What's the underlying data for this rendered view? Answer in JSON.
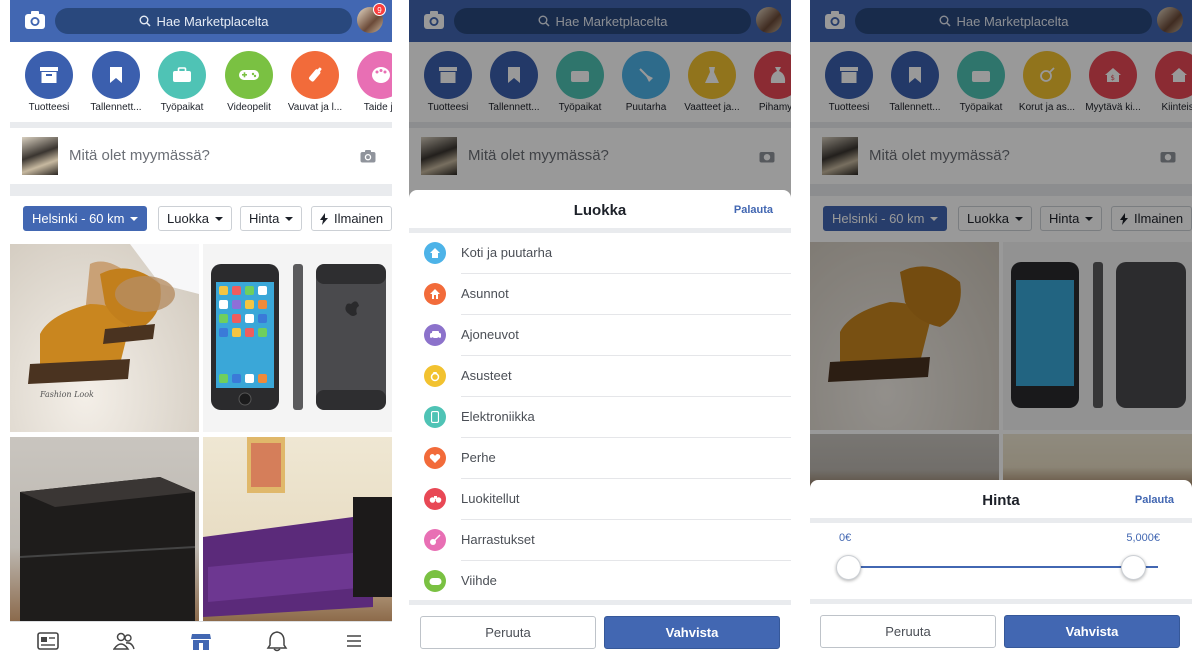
{
  "header": {
    "search_placeholder": "Hae Marketplacelta",
    "notifications": "9"
  },
  "screen1": {
    "categories": [
      {
        "label": "Tuotteesi",
        "color": "#3b5fae",
        "icon": "box-icon"
      },
      {
        "label": "Tallennett...",
        "color": "#3b5fae",
        "icon": "bookmark-icon"
      },
      {
        "label": "Työpaikat",
        "color": "#4fc3b5",
        "icon": "briefcase-icon"
      },
      {
        "label": "Videopelit",
        "color": "#7ac142",
        "icon": "gamepad-icon"
      },
      {
        "label": "Vauvat ja l...",
        "color": "#f26b3a",
        "icon": "baby-bottle-icon"
      },
      {
        "label": "Taide ja",
        "color": "#e86fb4",
        "icon": "palette-icon"
      }
    ],
    "composer_placeholder": "Mitä olet myymässä?",
    "filters": {
      "location": "Helsinki - 60 km",
      "category": "Luokka",
      "price": "Hinta",
      "free": "Ilmainen"
    }
  },
  "screen2": {
    "categories": [
      {
        "label": "Tuotteesi",
        "color": "#3b5fae",
        "icon": "box-icon"
      },
      {
        "label": "Tallennett...",
        "color": "#3b5fae",
        "icon": "bookmark-icon"
      },
      {
        "label": "Työpaikat",
        "color": "#4fc3b5",
        "icon": "briefcase-icon"
      },
      {
        "label": "Puutarha",
        "color": "#4db3e8",
        "icon": "shovel-icon"
      },
      {
        "label": "Vaatteet ja...",
        "color": "#f2c230",
        "icon": "dress-icon"
      },
      {
        "label": "Pihamyy",
        "color": "#e84855",
        "icon": "money-bag-icon"
      }
    ],
    "sheet": {
      "title": "Luokka",
      "reset": "Palauta",
      "items": [
        {
          "label": "Koti ja puutarha",
          "color": "#4db3e8",
          "icon": "house-icon"
        },
        {
          "label": "Asunnot",
          "color": "#f26b3a",
          "icon": "home-icon"
        },
        {
          "label": "Ajoneuvot",
          "color": "#8c72cb",
          "icon": "car-icon"
        },
        {
          "label": "Asusteet",
          "color": "#f2c230",
          "icon": "ring-icon"
        },
        {
          "label": "Elektroniikka",
          "color": "#4fc3b5",
          "icon": "phone-icon"
        },
        {
          "label": "Perhe",
          "color": "#f26b3a",
          "icon": "heart-icon"
        },
        {
          "label": "Luokitellut",
          "color": "#e84855",
          "icon": "binoculars-icon"
        },
        {
          "label": "Harrastukset",
          "color": "#e86fb4",
          "icon": "guitar-icon"
        },
        {
          "label": "Viihde",
          "color": "#7ac142",
          "icon": "gamepad-icon"
        }
      ],
      "cancel": "Peruuta",
      "confirm": "Vahvista"
    }
  },
  "screen3": {
    "categories": [
      {
        "label": "Tuotteesi",
        "color": "#3b5fae",
        "icon": "box-icon"
      },
      {
        "label": "Tallennett...",
        "color": "#3b5fae",
        "icon": "bookmark-icon"
      },
      {
        "label": "Työpaikat",
        "color": "#4fc3b5",
        "icon": "briefcase-icon"
      },
      {
        "label": "Korut ja as...",
        "color": "#f2c230",
        "icon": "ring-icon"
      },
      {
        "label": "Myytävä ki...",
        "color": "#e84855",
        "icon": "house-dollar-icon"
      },
      {
        "label": "Kiinteist",
        "color": "#e84855",
        "icon": "house-icon"
      }
    ],
    "sheet": {
      "title": "Hinta",
      "reset": "Palauta",
      "min_label": "0€",
      "max_label": "5,000€",
      "cancel": "Peruuta",
      "confirm": "Vahvista"
    }
  }
}
